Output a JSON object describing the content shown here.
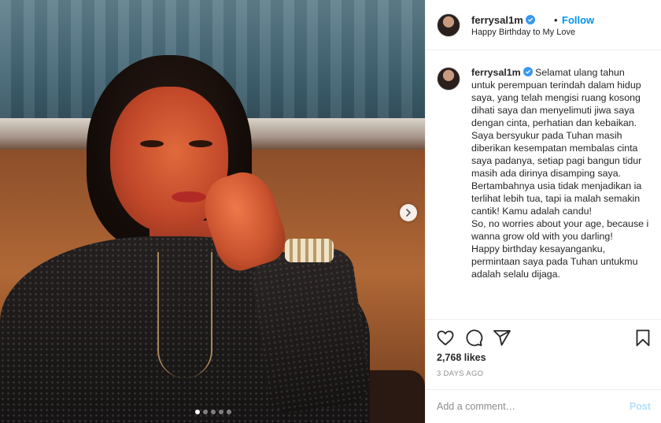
{
  "header": {
    "username": "ferrysal1m",
    "separator": "•",
    "follow_label": "Follow",
    "subtitle": "Happy Birthday to My Love",
    "more_label": "•••"
  },
  "carousel": {
    "slide_count": 5,
    "active_index": 0
  },
  "caption": {
    "username": "ferrysal1m",
    "paragraphs": [
      "Selamat ulang tahun untuk perempuan terindah dalam hidup saya, yang telah mengisi ruang kosong dihati saya dan menyelimuti jiwa saya dengan cinta, perhatian dan kebaikan.",
      "Saya bersyukur pada Tuhan masih diberikan kesempatan membalas cinta saya padanya, setiap pagi bangun tidur masih ada dirinya disamping saya.",
      "Bertambahnya usia tidak menjadikan ia terlihat lebih tua, tapi ia malah semakin cantik! Kamu adalah candu!",
      "So, no worries about your age, because i wanna grow old with you darling!",
      "Happy birthday kesayanganku, permintaan saya pada Tuhan untukmu adalah selalu dijaga."
    ]
  },
  "stats": {
    "likes": "2,768 likes",
    "posted": "3 DAYS AGO"
  },
  "comment": {
    "placeholder": "Add a comment…",
    "post_label": "Post"
  },
  "colors": {
    "link_blue": "#0095f6",
    "post_disabled": "#b2dffc",
    "verified_blue": "#3897f0",
    "muted": "#8e8e8e"
  },
  "icons": {
    "like": "heart-icon",
    "comment": "comment-bubble-icon",
    "share": "paper-plane-icon",
    "save": "bookmark-icon",
    "next": "chevron-right-icon",
    "verified": "verified-badge-icon"
  }
}
